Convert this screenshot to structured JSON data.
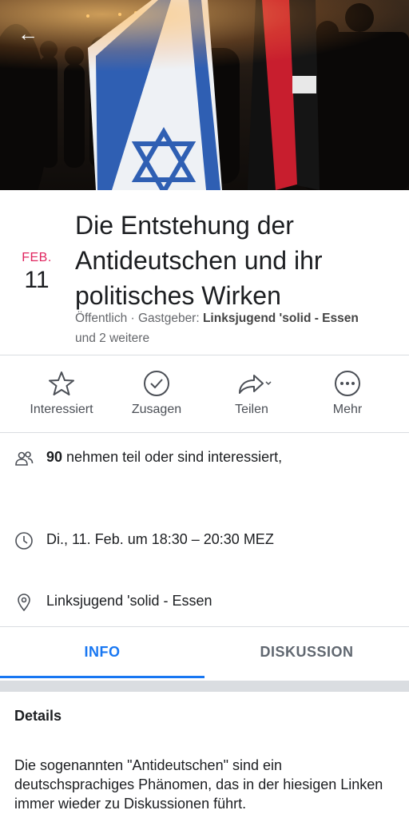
{
  "event": {
    "month": "FEB.",
    "day": "11",
    "title": "Die Entstehung der Antideutschen und ihr politisches Wirken",
    "visibility": "Öffentlich · Gastgeber: ",
    "host": "Linksjugend 'solid - Essen",
    "host_more": "und 2 weitere"
  },
  "actions": {
    "interested": "Interessiert",
    "going": "Zusagen",
    "share": "Teilen",
    "more": "Mehr"
  },
  "info": {
    "attendees_count": "90",
    "attendees_text": " nehmen teil oder sind interessiert,",
    "datetime": "Di., 11. Feb. um 18:30 – 20:30 MEZ",
    "location": "Linksjugend 'solid - Essen"
  },
  "tabs": {
    "info": "INFO",
    "discussion": "DISKUSSION"
  },
  "details": {
    "title": "Details",
    "text": "Die sogenannten \"Antideutschen\" sind ein deutschsprachiges Phänomen, das in der hiesigen Linken immer wieder zu Diskussionen führt."
  },
  "colors": {
    "accent": "#1877f2",
    "date_red": "#e0245e"
  }
}
